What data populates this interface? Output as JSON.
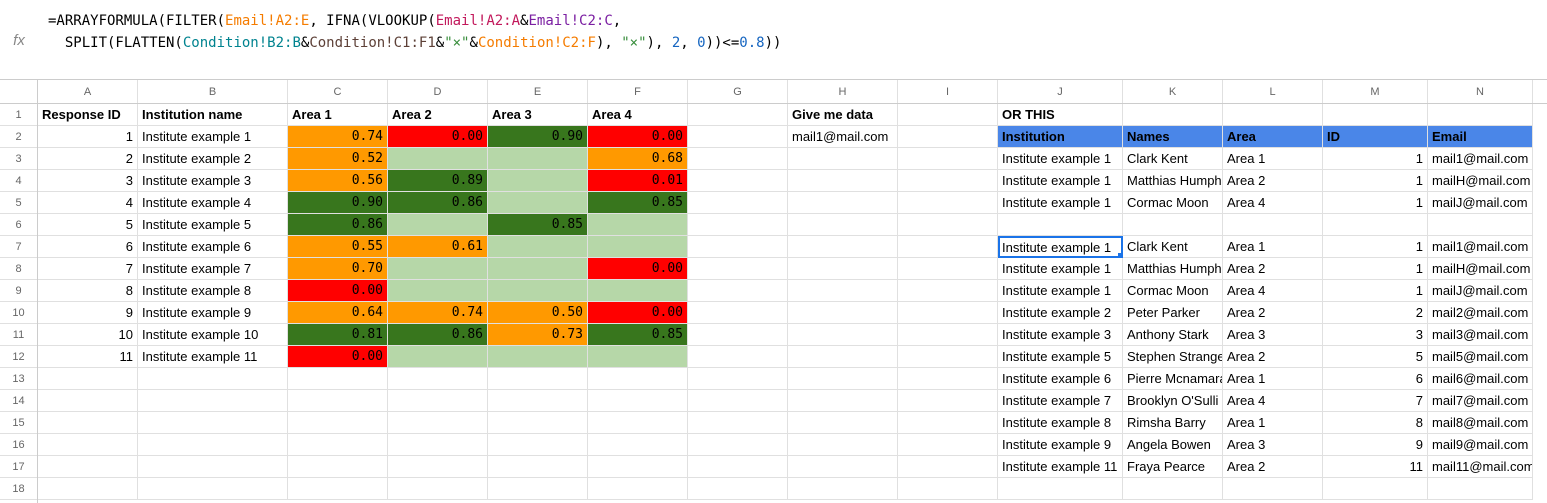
{
  "fx_label": "fx",
  "formula": {
    "line1": {
      "p1": "=ARRAYFORMULA(FILTER(",
      "ref_a": "Email!A2:E",
      "p2": ", IFNA(VLOOKUP(",
      "ref_b": "Email!A2:A",
      "amp1": "&",
      "ref_c": "Email!C2:C",
      "p3": ","
    },
    "line2": {
      "p1": "  SPLIT(FLATTEN(",
      "ref_d": "Condition!B2:B",
      "amp1": "&",
      "ref_e": "Condition!C1:F1",
      "amp2": "&",
      "str1": "\"×\"",
      "amp3": "&",
      "ref_f": "Condition!C2:F",
      "p2": "), ",
      "str2": "\"×\"",
      "p3": "), ",
      "num1": "2",
      "p4": ", ",
      "num2": "0",
      "p5": "))<=",
      "num3": "0.8",
      "p6": "))"
    }
  },
  "columns": [
    "A",
    "B",
    "C",
    "D",
    "E",
    "F",
    "G",
    "H",
    "I",
    "J",
    "K",
    "L",
    "M",
    "N"
  ],
  "row_numbers": [
    "1",
    "2",
    "3",
    "4",
    "5",
    "6",
    "7",
    "8",
    "9",
    "10",
    "11",
    "12",
    "13",
    "14",
    "15",
    "16",
    "17",
    "18"
  ],
  "headers_row": {
    "A": "Response ID",
    "B": "Institution name",
    "C": "Area 1",
    "D": "Area 2",
    "E": "Area 3",
    "F": "Area 4",
    "H": "Give me data",
    "J": "OR THIS"
  },
  "blue_headers": {
    "J": "Institution",
    "K": "Names",
    "L": "Area",
    "M": "ID",
    "N": "Email"
  },
  "left_data": [
    {
      "id": "1",
      "inst": "Institute example 1",
      "a1": "0.74",
      "a2": "0.00",
      "a3": "0.90",
      "a4": "0.00"
    },
    {
      "id": "2",
      "inst": "Institute example 2",
      "a1": "0.52",
      "a2": "",
      "a3": "",
      "a4": "0.68"
    },
    {
      "id": "3",
      "inst": "Institute example 3",
      "a1": "0.56",
      "a2": "0.89",
      "a3": "",
      "a4": "0.01"
    },
    {
      "id": "4",
      "inst": "Institute example 4",
      "a1": "0.90",
      "a2": "0.86",
      "a3": "",
      "a4": "0.85"
    },
    {
      "id": "5",
      "inst": "Institute example 5",
      "a1": "0.86",
      "a2": "",
      "a3": "0.85",
      "a4": ""
    },
    {
      "id": "6",
      "inst": "Institute example 6",
      "a1": "0.55",
      "a2": "0.61",
      "a3": "",
      "a4": ""
    },
    {
      "id": "7",
      "inst": "Institute example 7",
      "a1": "0.70",
      "a2": "",
      "a3": "",
      "a4": "0.00"
    },
    {
      "id": "8",
      "inst": "Institute example 8",
      "a1": "0.00",
      "a2": "",
      "a3": "",
      "a4": ""
    },
    {
      "id": "9",
      "inst": "Institute example 9",
      "a1": "0.64",
      "a2": "0.74",
      "a3": "0.50",
      "a4": "0.00"
    },
    {
      "id": "10",
      "inst": "Institute example 10",
      "a1": "0.81",
      "a2": "0.86",
      "a3": "0.73",
      "a4": "0.85"
    },
    {
      "id": "11",
      "inst": "Institute example 11",
      "a1": "0.00",
      "a2": "",
      "a3": "",
      "a4": ""
    }
  ],
  "h2": "mail1@mail.com",
  "right_top": [
    {
      "inst": "Institute example 1",
      "name": "Clark Kent",
      "area": "Area 1",
      "id": "1",
      "email": "mail1@mail.com"
    },
    {
      "inst": "Institute example 1",
      "name": "Matthias Humph",
      "area": "Area 2",
      "id": "1",
      "email": "mailH@mail.com"
    },
    {
      "inst": "Institute example 1",
      "name": "Cormac Moon",
      "area": "Area 4",
      "id": "1",
      "email": "mailJ@mail.com"
    }
  ],
  "right_bottom": [
    {
      "inst": "Institute example 1",
      "name": "Clark Kent",
      "area": "Area 1",
      "id": "1",
      "email": "mail1@mail.com"
    },
    {
      "inst": "Institute example 1",
      "name": "Matthias Humph",
      "area": "Area 2",
      "id": "1",
      "email": "mailH@mail.com"
    },
    {
      "inst": "Institute example 1",
      "name": "Cormac Moon",
      "area": "Area 4",
      "id": "1",
      "email": "mailJ@mail.com"
    },
    {
      "inst": "Institute example 2",
      "name": "Peter Parker",
      "area": "Area 2",
      "id": "2",
      "email": "mail2@mail.com"
    },
    {
      "inst": "Institute example 3",
      "name": "Anthony Stark",
      "area": "Area 3",
      "id": "3",
      "email": "mail3@mail.com"
    },
    {
      "inst": "Institute example 5",
      "name": "Stephen Strange",
      "area": "Area 2",
      "id": "5",
      "email": "mail5@mail.com"
    },
    {
      "inst": "Institute example 6",
      "name": "Pierre Mcnamara",
      "area": "Area 1",
      "id": "6",
      "email": "mail6@mail.com"
    },
    {
      "inst": "Institute example 7",
      "name": "Brooklyn O'Sulli",
      "area": "Area 4",
      "id": "7",
      "email": "mail7@mail.com"
    },
    {
      "inst": "Institute example 8",
      "name": "Rimsha Barry",
      "area": "Area 1",
      "id": "8",
      "email": "mail8@mail.com"
    },
    {
      "inst": "Institute example 9",
      "name": "Angela Bowen",
      "area": "Area 3",
      "id": "9",
      "email": "mail9@mail.com"
    },
    {
      "inst": "Institute example 11",
      "name": "Fraya Pearce",
      "area": "Area 2",
      "id": "11",
      "email": "mail11@mail.com"
    }
  ],
  "col_widths": {
    "A": 100,
    "B": 150,
    "C": 100,
    "D": 100,
    "E": 100,
    "F": 100,
    "G": 100,
    "H": 110,
    "I": 100,
    "J": 125,
    "K": 100,
    "L": 100,
    "M": 105,
    "N": 105
  }
}
